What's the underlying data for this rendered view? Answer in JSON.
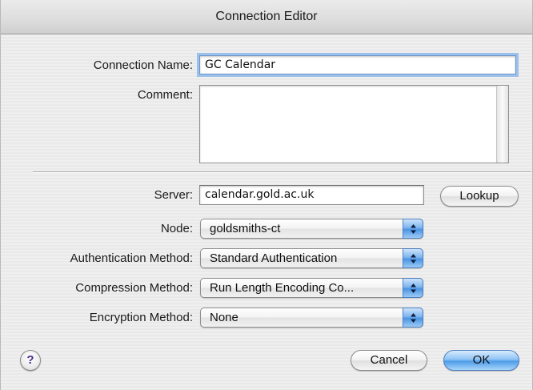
{
  "window": {
    "title": "Connection Editor"
  },
  "form": {
    "connection_name": {
      "label": "Connection Name:",
      "value": "GC Calendar"
    },
    "comment": {
      "label": "Comment:",
      "value": ""
    },
    "server": {
      "label": "Server:",
      "value": "calendar.gold.ac.uk",
      "lookup_label": "Lookup"
    },
    "node": {
      "label": "Node:",
      "selected": "goldsmiths-ct"
    },
    "authentication": {
      "label": "Authentication Method:",
      "selected": "Standard Authentication"
    },
    "compression": {
      "label": "Compression Method:",
      "selected": "Run Length Encoding Co..."
    },
    "encryption": {
      "label": "Encryption Method:",
      "selected": "None"
    }
  },
  "footer": {
    "help_label": "?",
    "cancel_label": "Cancel",
    "ok_label": "OK"
  },
  "colors": {
    "accent": "#4e9ce8",
    "focus_ring": "#9cc1ea"
  },
  "icons": {
    "popup_arrows": "updown-arrows-icon",
    "help": "help-icon"
  }
}
